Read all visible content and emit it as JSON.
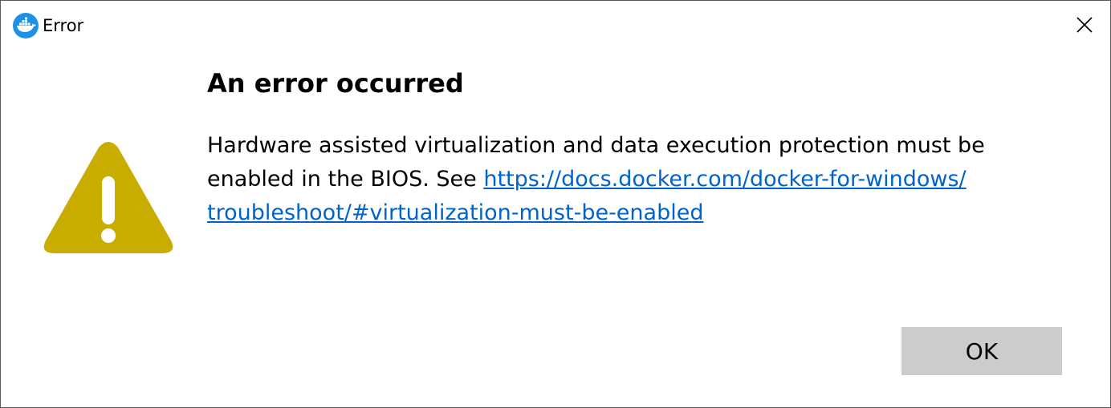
{
  "window": {
    "title": "Error",
    "app_icon": "docker-whale-icon",
    "close_icon": "close-icon"
  },
  "dialog": {
    "icon": "warning-icon",
    "icon_color": "#c9ac00",
    "heading": "An error occurred",
    "message_prefix": "Hardware assisted virtualization and data execution protection must be enabled in the BIOS. See ",
    "link_text_line1": "https://docs.docker.com/docker-for-windows/",
    "link_text_line2": "troubleshoot/#virtualization-must-be-enabled",
    "link_color": "#0063cc"
  },
  "buttons": {
    "ok_label": "OK"
  }
}
